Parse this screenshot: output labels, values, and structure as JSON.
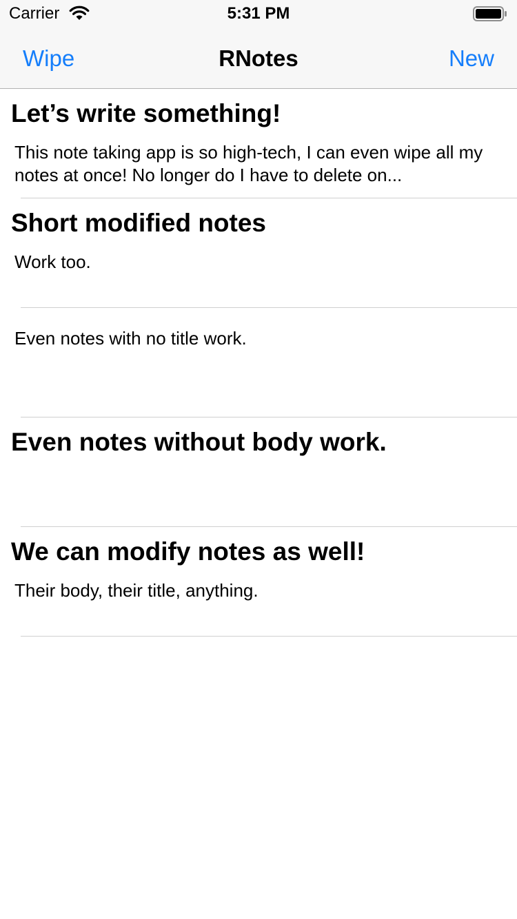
{
  "status_bar": {
    "carrier": "Carrier",
    "time": "5:31 PM"
  },
  "nav": {
    "left_button": "Wipe",
    "title": "RNotes",
    "right_button": "New",
    "accent_color": "#157efb"
  },
  "notes": [
    {
      "title": "Let’s write something!",
      "body": "This note taking app is so high-tech, I can even wipe all my notes at once! No longer do I have to delete on..."
    },
    {
      "title": "Short modified notes",
      "body": "Work too."
    },
    {
      "title": "",
      "body": "Even notes with no title work."
    },
    {
      "title": "Even notes without body work.",
      "body": ""
    },
    {
      "title": "We can modify notes as well!",
      "body": "Their body, their title, anything."
    }
  ]
}
